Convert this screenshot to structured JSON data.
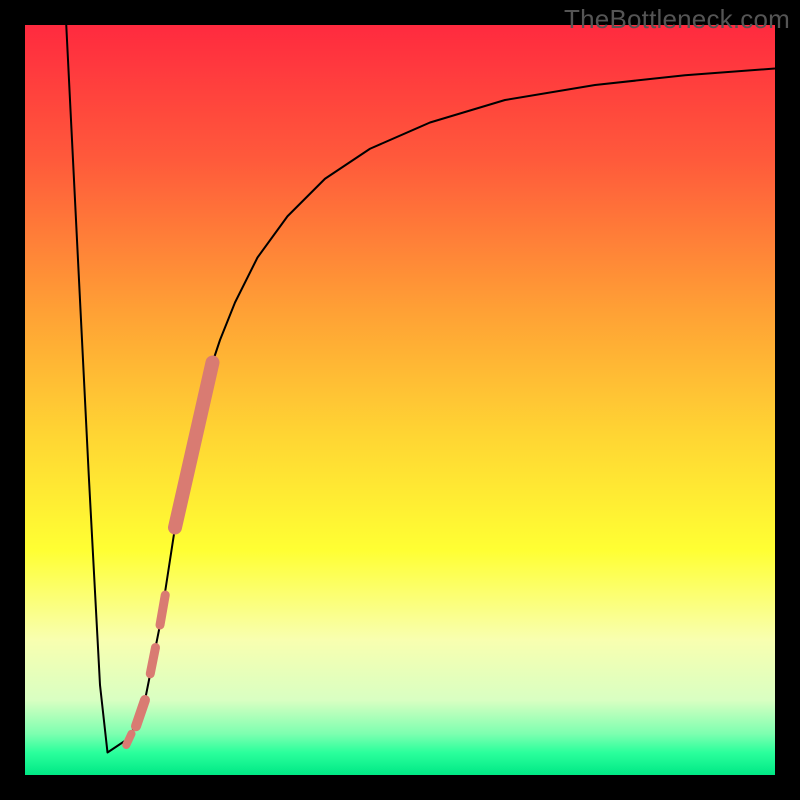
{
  "watermark": "TheBottleneck.com",
  "chart_data": {
    "type": "line",
    "title": "",
    "xlabel": "",
    "ylabel": "",
    "xlim": [
      0,
      100
    ],
    "ylim": [
      0,
      100
    ],
    "background": {
      "type": "vertical-gradient",
      "stops": [
        {
          "offset": 0.0,
          "color": "#ff2a3f"
        },
        {
          "offset": 0.18,
          "color": "#ff5a3b"
        },
        {
          "offset": 0.38,
          "color": "#ffa035"
        },
        {
          "offset": 0.55,
          "color": "#ffd633"
        },
        {
          "offset": 0.7,
          "color": "#ffff33"
        },
        {
          "offset": 0.82,
          "color": "#f8ffb0"
        },
        {
          "offset": 0.9,
          "color": "#d9ffc2"
        },
        {
          "offset": 0.945,
          "color": "#7dffb0"
        },
        {
          "offset": 0.97,
          "color": "#2bff9c"
        },
        {
          "offset": 1.0,
          "color": "#00e885"
        }
      ]
    },
    "series": [
      {
        "name": "bottleneck-curve",
        "color": "#000000",
        "stroke_width": 2,
        "x": [
          5.5,
          7.0,
          8.5,
          10.0,
          11.0,
          12.5,
          14.0,
          16.0,
          18.0,
          20.0,
          22.0,
          24.0,
          26.0,
          28.0,
          31.0,
          35.0,
          40.0,
          46.0,
          54.0,
          64.0,
          76.0,
          88.0,
          100.0
        ],
        "y": [
          100.0,
          70.0,
          40.0,
          12.0,
          3.0,
          4.0,
          5.0,
          10.0,
          20.0,
          33.0,
          44.0,
          52.0,
          58.0,
          63.0,
          69.0,
          74.5,
          79.5,
          83.5,
          87.0,
          90.0,
          92.0,
          93.3,
          94.2
        ]
      }
    ],
    "highlight_band": {
      "name": "highlighted-range",
      "color": "#d97b72",
      "segments": [
        {
          "x": [
            20.0,
            25.0
          ],
          "y": [
            33.0,
            55.0
          ],
          "width": 14
        },
        {
          "x": [
            18.0,
            18.7
          ],
          "y": [
            20.0,
            24.0
          ],
          "width": 9
        },
        {
          "x": [
            16.7,
            17.4
          ],
          "y": [
            13.5,
            17.0
          ],
          "width": 9
        },
        {
          "x": [
            14.8,
            16.0
          ],
          "y": [
            6.5,
            10.0
          ],
          "width": 10
        },
        {
          "x": [
            13.5,
            14.2
          ],
          "y": [
            4.0,
            5.5
          ],
          "width": 8
        }
      ]
    },
    "frame": {
      "color": "#000000",
      "inset": 25
    }
  }
}
